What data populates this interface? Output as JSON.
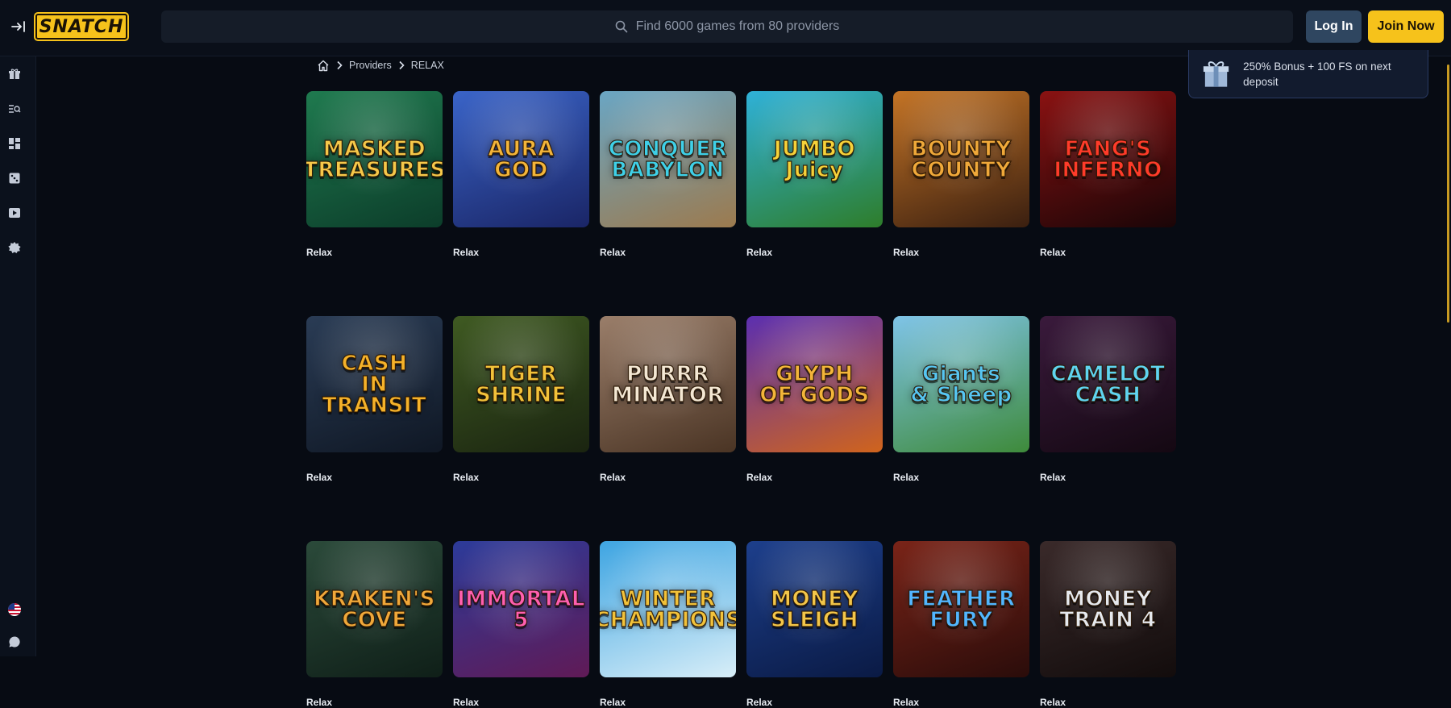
{
  "header": {
    "logo_text": "SNATCH",
    "search_placeholder": "Find 6000 games from 80 providers",
    "login_label": "Log In",
    "join_label": "Join Now"
  },
  "rail": {
    "items": [
      "gift-icon",
      "search-list-icon",
      "grid-icon",
      "dice-icon",
      "play-icon",
      "badge-icon"
    ],
    "bottom": [
      "us-flag-icon",
      "chat-icon"
    ]
  },
  "bonus": {
    "text": "250% Bonus + 100 FS on next deposit"
  },
  "breadcrumb": {
    "providers": "Providers",
    "current": "RELAX"
  },
  "colors": {
    "accent": "#f6c21b",
    "login_bg": "#2f4660",
    "background": "#070b13"
  },
  "games": [
    {
      "title": "MASKED\nTREASURES",
      "provider": "Relax",
      "bg1": "#1f7a4f",
      "bg2": "#0c3d2a",
      "fg": "#f5c84a"
    },
    {
      "title": "AURA\nGOD",
      "provider": "Relax",
      "bg1": "#3a64c8",
      "bg2": "#1a2566",
      "fg": "#f3b53a"
    },
    {
      "title": "CONQUER\nBABYLON",
      "provider": "Relax",
      "bg1": "#6aa6c4",
      "bg2": "#9c7a4e",
      "fg": "#3fd0e8"
    },
    {
      "title": "JUMBO\nJuicy",
      "provider": "Relax",
      "bg1": "#2fb1d8",
      "bg2": "#2e7d2a",
      "fg": "#f6d23a"
    },
    {
      "title": "BOUNTY\nCOUNTY",
      "provider": "Relax",
      "bg1": "#c47426",
      "bg2": "#3a1f10",
      "fg": "#f0a93a"
    },
    {
      "title": "FANG'S\nINFERNO",
      "provider": "Relax",
      "bg1": "#8a1212",
      "bg2": "#1a0507",
      "fg": "#ff3b2a"
    },
    {
      "title": "CASH\nIN TRANSIT",
      "provider": "Relax",
      "bg1": "#2a3c55",
      "bg2": "#0f1724",
      "fg": "#f5b22a"
    },
    {
      "title": "TIGER\nSHRINE",
      "provider": "Relax",
      "bg1": "#3f5a22",
      "bg2": "#1a2410",
      "fg": "#f2c23a"
    },
    {
      "title": "PURRR\nMINATOR",
      "provider": "Relax",
      "bg1": "#9a7e6a",
      "bg2": "#4a3424",
      "fg": "#f4e8d4"
    },
    {
      "title": "GLYPH\nOF GODS",
      "provider": "Relax",
      "bg1": "#5b2fb0",
      "bg2": "#d0641c",
      "fg": "#f3b53a"
    },
    {
      "title": "Giants\n& Sheep",
      "provider": "Relax",
      "bg1": "#7fc4e8",
      "bg2": "#3e8a3a",
      "fg": "#56c6f2"
    },
    {
      "title": "CAMELOT\nCASH",
      "provider": "Relax",
      "bg1": "#3a1a3c",
      "bg2": "#140812",
      "fg": "#5fd4f0"
    },
    {
      "title": "KRAKEN'S\nCOVE",
      "provider": "Relax",
      "bg1": "#2b4a3a",
      "bg2": "#0f1f18",
      "fg": "#f0a83a"
    },
    {
      "title": "IMMORTAL\n5",
      "provider": "Relax",
      "bg1": "#2c3b9a",
      "bg2": "#601a56",
      "fg": "#ff5fb0"
    },
    {
      "title": "WINTER\nCHAMPIONS",
      "provider": "Relax",
      "bg1": "#3ea5e2",
      "bg2": "#d8eef8",
      "fg": "#f2c23a"
    },
    {
      "title": "MONEY\nSLEIGH",
      "provider": "Relax",
      "bg1": "#1d3f8c",
      "bg2": "#0a1a44",
      "fg": "#f3c64a"
    },
    {
      "title": "FEATHER\nFURY",
      "provider": "Relax",
      "bg1": "#7a2418",
      "bg2": "#2a0c0a",
      "fg": "#52b6ff"
    },
    {
      "title": "MONEY\nTRAIN 4",
      "provider": "Relax",
      "bg1": "#3a2a2a",
      "bg2": "#120c0c",
      "fg": "#e6e9ee"
    }
  ]
}
